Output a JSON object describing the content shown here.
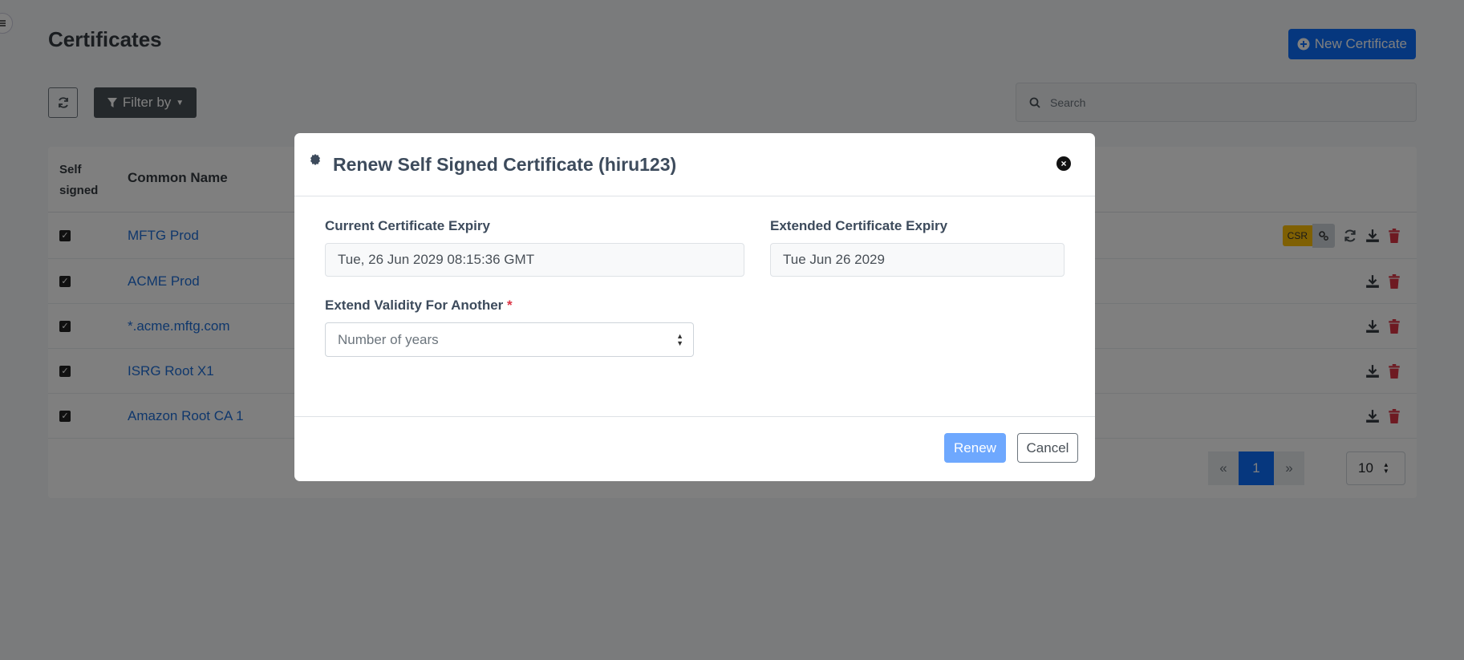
{
  "page": {
    "title": "Certificates",
    "new_button_label": "New Certificate",
    "filter_label": "Filter by",
    "search_placeholder": "Search",
    "columns": [
      "Self signed",
      "Common Name"
    ],
    "rows": [
      {
        "name": "MFTG Prod",
        "self_signed": true,
        "csr_label": "CSR"
      },
      {
        "name": "ACME Prod",
        "self_signed": true
      },
      {
        "name": "*.acme.mftg.com",
        "self_signed": true
      },
      {
        "name": "ISRG Root X1",
        "self_signed": true
      },
      {
        "name": "Amazon Root CA 1",
        "self_signed": true
      }
    ],
    "pagination": {
      "prev": "«",
      "current": "1",
      "next": "»",
      "page_size": "10"
    }
  },
  "modal": {
    "title": "Renew Self Signed Certificate (hiru123)",
    "current_expiry_label": "Current Certificate Expiry",
    "current_expiry_value": "Tue, 26 Jun 2029 08:15:36 GMT",
    "extended_expiry_label": "Extended Certificate Expiry",
    "extended_expiry_value": "Tue Jun 26 2029",
    "extend_label": "Extend Validity For Another",
    "required_mark": "*",
    "years_placeholder": "Number of years",
    "renew_label": "Renew",
    "cancel_label": "Cancel"
  },
  "colors": {
    "primary": "#0d6efd",
    "link": "#1f6fd8",
    "danger": "#dc3545",
    "warning": "#ffc107"
  }
}
